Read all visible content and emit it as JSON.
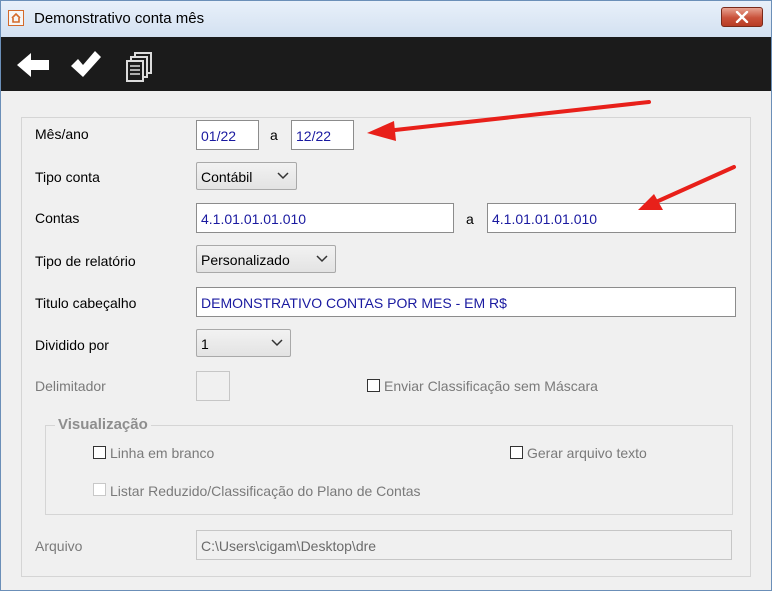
{
  "window": {
    "title": "Demonstrativo conta mês"
  },
  "toolbar": {
    "icons": [
      "back-arrow-icon",
      "checkmark-icon",
      "copy-pages-icon"
    ]
  },
  "form": {
    "mes_ano": {
      "label": "Mês/ano",
      "from": "01/22",
      "sep": "a",
      "to": "12/22"
    },
    "tipo_conta": {
      "label": "Tipo conta",
      "value": "Contábil"
    },
    "contas": {
      "label": "Contas",
      "from": "4.1.01.01.01.010",
      "sep": "a",
      "to": "4.1.01.01.01.010"
    },
    "tipo_relatorio": {
      "label": "Tipo de relatório",
      "value": "Personalizado"
    },
    "titulo": {
      "label": "Titulo cabeçalho",
      "value": "DEMONSTRATIVO CONTAS POR MES  - EM R$"
    },
    "dividido": {
      "label": "Dividido por",
      "value": "1"
    },
    "delimitador": {
      "label": "Delimitador",
      "value": ""
    },
    "enviar_classificacao": {
      "label": "Enviar Classificação sem Máscara",
      "checked": false
    },
    "visualizacao": {
      "title": "Visualização",
      "linha_branco": {
        "label": "Linha em branco",
        "checked": false
      },
      "gerar_texto": {
        "label": "Gerar arquivo texto",
        "checked": false
      },
      "listar_reduzido": {
        "label": "Listar Reduzido/Classificação do Plano de Contas",
        "checked": false
      }
    },
    "arquivo": {
      "label": "Arquivo",
      "value": "C:\\Users\\cigam\\Desktop\\dre"
    }
  },
  "colors": {
    "toolbar_bg": "#1b1b1b",
    "field_text": "#1a1aa0",
    "annotation_arrow": "#e8201a"
  }
}
